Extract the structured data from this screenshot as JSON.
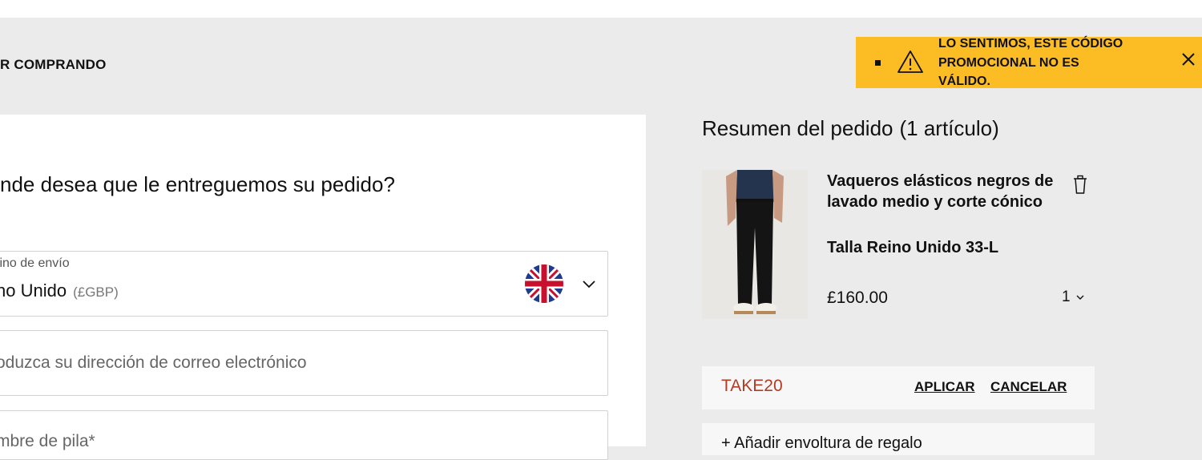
{
  "header": {
    "continue_shopping": "R COMPRANDO"
  },
  "toast": {
    "message": "LO SENTIMOS, ESTE CÓDIGO PROMOCIONAL NO ES VÁLIDO.",
    "bg_color": "#fbbc24",
    "icon": "warning-icon",
    "close_icon": "close-icon"
  },
  "form": {
    "title": "nde desea que le entreguemos su pedido?",
    "country": {
      "label": "tino de envío",
      "value": "no Unido",
      "currency": "(£GBP)",
      "flag": "uk-flag-icon"
    },
    "email": {
      "placeholder": "oduzca su dirección de correo electrónico"
    },
    "first_name": {
      "placeholder": "mbre de pila*"
    }
  },
  "summary": {
    "title": "Resumen del pedido",
    "count": "(1 artículo)",
    "item": {
      "name": "Vaqueros elásticos negros de lavado medio y corte cónico",
      "size": "Talla Reino Unido 33-L",
      "price": "£160.00",
      "quantity": "1"
    },
    "promo": {
      "code": "TAKE20",
      "apply_label": "APLICAR",
      "cancel_label": "CANCELAR",
      "code_color": "#b23b26"
    },
    "gift_wrap": "+ Añadir envoltura de regalo"
  }
}
